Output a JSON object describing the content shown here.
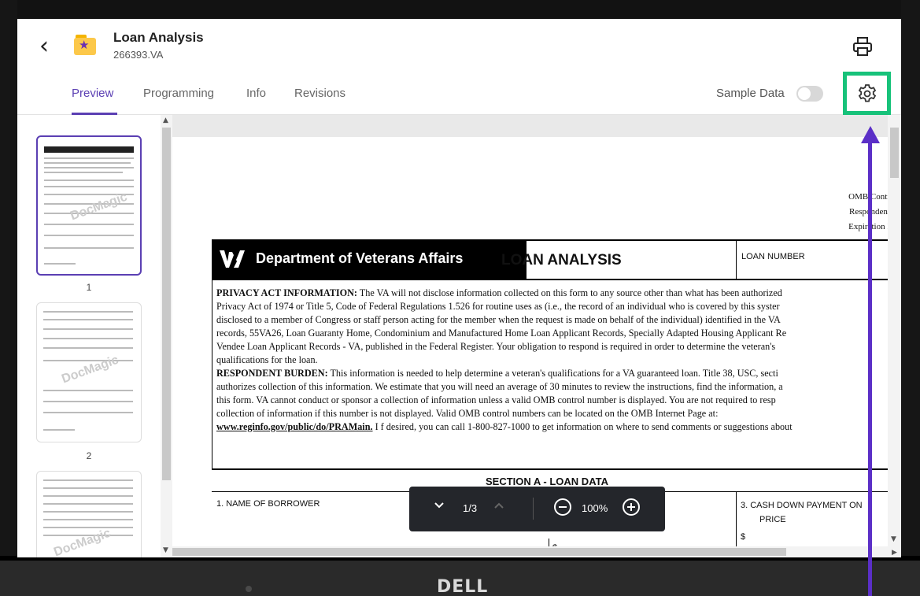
{
  "header": {
    "title": "Loan Analysis",
    "subtitle": "266393.VA",
    "back_icon": "chevron-left-icon",
    "folder_icon": "star-folder-icon",
    "print_icon": "printer-icon"
  },
  "tabs": [
    {
      "label": "Preview",
      "active": true
    },
    {
      "label": "Programming",
      "active": false
    },
    {
      "label": "Info",
      "active": false
    },
    {
      "label": "Revisions",
      "active": false
    }
  ],
  "sample_data": {
    "label": "Sample Data",
    "enabled": false
  },
  "settings_icon": "gear-icon",
  "thumbnails": [
    {
      "page": "1",
      "selected": true,
      "watermark": "DocMagic"
    },
    {
      "page": "2",
      "selected": false,
      "watermark": "DocMagic"
    },
    {
      "page": "",
      "selected": false,
      "watermark": "DocMagic"
    }
  ],
  "document": {
    "omb_lines": [
      "OMB Contr",
      "Respondent",
      "Expiration I"
    ],
    "agency": "Department of Veterans Affairs",
    "form_title": "LOAN ANALYSIS",
    "loan_number_label": "LOAN NUMBER",
    "privacy_heading": "PRIVACY ACT INFORMATION:",
    "privacy_lines": [
      " The VA will not disclose information collected on this form to any source other than what has been authorized",
      "Privacy Act of 1974 or Title 5, Code of Federal Regulations 1.526 for routine uses as (i.e., the record of an individual who is covered by this syster",
      "disclosed to a member of Congress or staff person acting for the member when the request is made on behalf of the individual) identified in the VA",
      "records, 55VA26, Loan Guaranty Home, Condominium and Manufactured Home Loan Applicant Records, Specially Adapted Housing Applicant Re",
      "Vendee Loan Applicant Records - VA, published in the Federal Register.  Your obligation to respond is required in order to determine the veteran's",
      "qualifications for the loan."
    ],
    "burden_heading": "RESPONDENT BURDEN:",
    "burden_lines": [
      " This information is needed to help determine a veteran's qualifications for a VA guaranteed loan.  Title 38, USC, secti",
      "authorizes collection of this information.  We estimate that you will need an average of 30 minutes to review the instructions, find the information, a",
      "this form.  VA cannot conduct or sponsor a collection of information unless a valid OMB control number is displayed.  You are not required to resp",
      "collection of information if this number is not displayed.  Valid OMB control numbers can be located on the OMB Internet Page at:"
    ],
    "link_text": "www.reginfo.gov/public/do/PRAMain.",
    "link_suffix": "  I  f desired, you can call 1-800-827-1000 to get information on where to send comments or suggestions about",
    "section_title": "SECTION A - LOAN DATA",
    "field_1": "1.   NAME OF BORROWER",
    "field_3_line1": "3.   CASH DOWN PAYMENT ON",
    "field_3_line2": "PRICE",
    "dollar": "$"
  },
  "pager": {
    "page_indicator": "1/3",
    "zoom": "100%",
    "prev_icon": "chevron-down-icon",
    "next_icon": "chevron-up-icon",
    "zoom_out_icon": "minus-circle-icon",
    "zoom_in_icon": "plus-circle-icon"
  },
  "device": {
    "brand": "DELL"
  },
  "colors": {
    "accent": "#5b3fb3",
    "highlight": "#17c27a",
    "annotation": "#5b2fc7"
  }
}
